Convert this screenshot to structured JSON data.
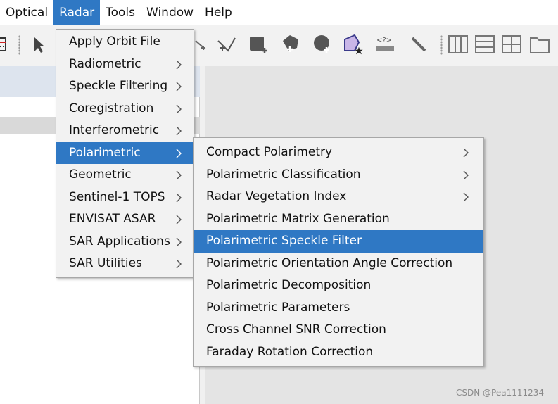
{
  "menubar": {
    "items": [
      {
        "label": "Optical"
      },
      {
        "label": "Radar"
      },
      {
        "label": "Tools"
      },
      {
        "label": "Window"
      },
      {
        "label": "Help"
      }
    ],
    "active": "Radar"
  },
  "toolbar": {
    "icons": [
      "graph-icon",
      "select-arrow-icon",
      "draw-line-icon",
      "draw-polyline-icon",
      "add-rectangle-icon",
      "add-shape-icon",
      "add-ellipse-icon",
      "pin-star-icon",
      "range-finder-icon",
      "magic-wand-icon",
      "tile-columns-icon",
      "tile-rows-icon",
      "tile-grid-icon",
      "folder-icon"
    ]
  },
  "radar_menu": {
    "items": [
      {
        "label": "Apply Orbit File",
        "submenu": false
      },
      {
        "label": "Radiometric",
        "submenu": true
      },
      {
        "label": "Speckle Filtering",
        "submenu": true
      },
      {
        "label": "Coregistration",
        "submenu": true
      },
      {
        "label": "Interferometric",
        "submenu": true
      },
      {
        "label": "Polarimetric",
        "submenu": true,
        "active": true
      },
      {
        "label": "Geometric",
        "submenu": true
      },
      {
        "label": "Sentinel-1 TOPS",
        "submenu": true
      },
      {
        "label": "ENVISAT ASAR",
        "submenu": true
      },
      {
        "label": "SAR Applications",
        "submenu": true
      },
      {
        "label": "SAR Utilities",
        "submenu": true
      }
    ]
  },
  "polarimetric_menu": {
    "items": [
      {
        "label": "Compact Polarimetry",
        "submenu": true
      },
      {
        "label": "Polarimetric Classification",
        "submenu": true
      },
      {
        "label": "Radar Vegetation Index",
        "submenu": true
      },
      {
        "label": "Polarimetric Matrix Generation",
        "submenu": false
      },
      {
        "label": "Polarimetric Speckle Filter",
        "submenu": false,
        "active": true
      },
      {
        "label": "Polarimetric Orientation Angle Correction",
        "submenu": false
      },
      {
        "label": "Polarimetric Decomposition",
        "submenu": false
      },
      {
        "label": "Polarimetric Parameters",
        "submenu": false
      },
      {
        "label": "Cross Channel SNR Correction",
        "submenu": false
      },
      {
        "label": "Faraday Rotation Correction",
        "submenu": false
      }
    ]
  },
  "watermark": "CSDN @Pea1111234",
  "colors": {
    "highlight": "#2f78c4",
    "menu_bg": "#f2f2f2",
    "workspace_bg": "#e4e4e4"
  }
}
